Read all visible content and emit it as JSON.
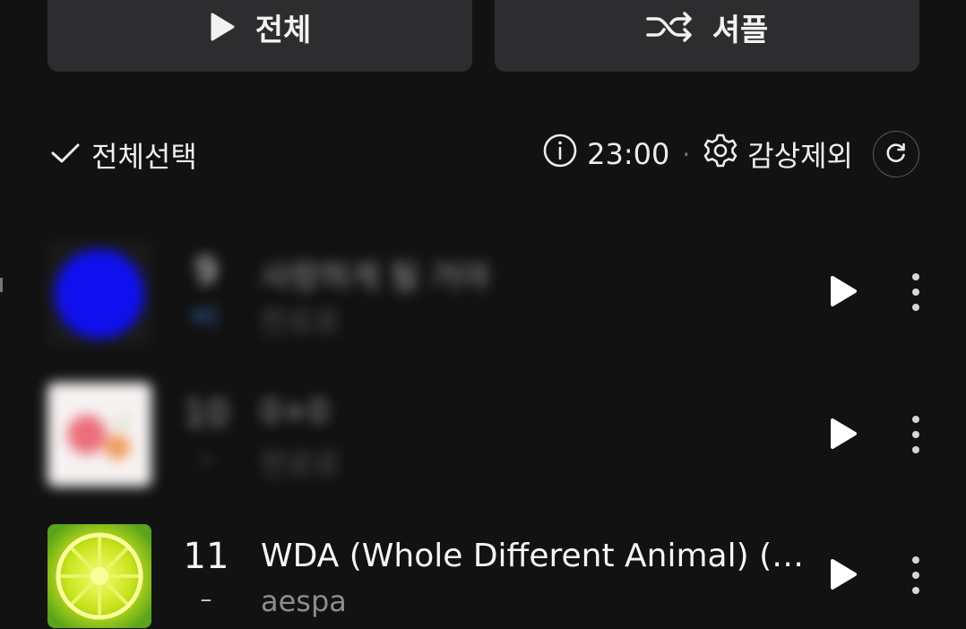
{
  "controls": {
    "play_all_label": "전체",
    "shuffle_label": "셔플"
  },
  "list_header": {
    "select_all_label": "전체선택",
    "time": "23:00",
    "separator": "·",
    "exclude_label": "감상제외"
  },
  "songs": [
    {
      "rank": "9",
      "change": "▾1",
      "title": "사랑하게 될 거야",
      "artist": "한로로",
      "blurred": true
    },
    {
      "rank": "10",
      "change": "–",
      "title": "0+0",
      "artist": "한로로",
      "blurred": true
    },
    {
      "rank": "11",
      "change": "–",
      "title": "WDA (Whole Different Animal) (…",
      "artist": "aespa",
      "blurred": false
    }
  ],
  "colors": {
    "background": "#121212",
    "button_bg": "#2d2d2f",
    "text_primary": "#f6f6f6",
    "text_secondary": "#8d8d8d",
    "rank_down": "#3b78d6"
  },
  "icons": {
    "play_all": "play-icon",
    "shuffle": "shuffle-icon",
    "select_all": "check-icon",
    "info": "info-icon",
    "settings": "gear-icon",
    "refresh": "refresh-icon",
    "row_play": "play-icon",
    "row_more": "more-vertical-icon"
  }
}
